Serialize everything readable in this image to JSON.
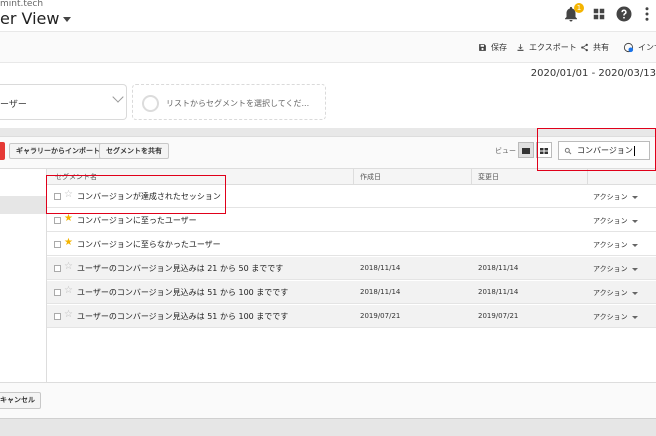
{
  "header": {
    "site": "mint.tech",
    "view_name": "er View",
    "notification_count": "1"
  },
  "toolbar": {
    "save": "保存",
    "export": "エクスポート",
    "share": "共有",
    "insights": "インサ"
  },
  "date_range": "2020/01/01 - 2020/03/13",
  "segments": {
    "selected": "ーザー",
    "placeholder": "リストからセグメントを選択してくだ..."
  },
  "panel_toolbar": {
    "import_gallery": "ギャラリーからインポート",
    "share_segment": "セグメントを共有",
    "view_label": "ビュー",
    "search_value": "コンバージョン"
  },
  "table": {
    "headers": {
      "name": "セグメント名",
      "created": "作成日",
      "modified": "変更日"
    },
    "rows": [
      {
        "name": "コンバージョンが達成されたセッション",
        "created": "",
        "modified": "",
        "starred": false,
        "action": "アクション"
      },
      {
        "name": "コンバージョンに至ったユーザー",
        "created": "",
        "modified": "",
        "starred": true,
        "action": "アクション"
      },
      {
        "name": "コンバージョンに至らなかったユーザー",
        "created": "",
        "modified": "",
        "starred": true,
        "action": "アクション"
      },
      {
        "name": "ユーザーのコンバージョン見込みは 21 から 50 までです",
        "created": "2018/11/14",
        "modified": "2018/11/14",
        "starred": false,
        "action": "アクション"
      },
      {
        "name": "ユーザーのコンバージョン見込みは 51 から 100 までです",
        "created": "2018/11/14",
        "modified": "2018/11/14",
        "starred": false,
        "action": "アクション"
      },
      {
        "name": "ユーザーのコンバージョン見込みは 51 から 100 までです",
        "created": "2019/07/21",
        "modified": "2019/07/21",
        "starred": false,
        "action": "アクション"
      }
    ]
  },
  "footer": {
    "cancel": "キャンセル"
  },
  "icons": {
    "notifications": "bell-icon",
    "apps": "apps-grid-icon",
    "help": "help-icon",
    "more": "more-vert-icon",
    "save": "save-icon",
    "export": "export-icon",
    "share": "share-icon",
    "insights": "insights-icon",
    "search": "search-icon",
    "star": "star-icon"
  },
  "colors": {
    "accent_red": "#e53935",
    "star": "#f4b400",
    "annotation": "#e0001a"
  }
}
